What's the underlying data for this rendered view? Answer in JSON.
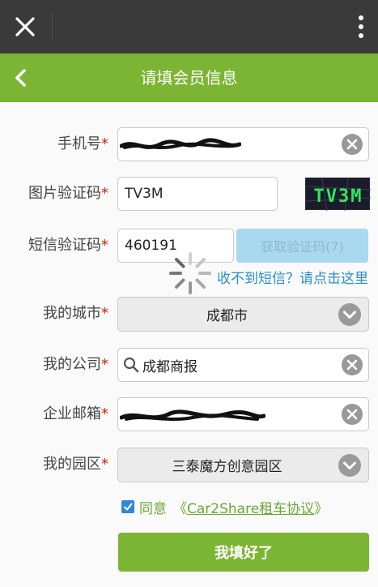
{
  "topbar": {
    "close_icon": "close-icon",
    "more_icon": "more-vertical-icon"
  },
  "navbar": {
    "back_icon": "chevron-left-icon",
    "title": "请填会员信息"
  },
  "form": {
    "phone": {
      "label": "手机号",
      "required_mark": "*"
    },
    "captcha": {
      "label": "图片验证码",
      "required_mark": "*",
      "value": "TV3M",
      "image_text": "TV3M"
    },
    "sms": {
      "label": "短信验证码",
      "required_mark": "*",
      "value": "460191",
      "button_label": "获取验证码(7)",
      "resend_link": "收不到短信？请点击这里"
    },
    "city": {
      "label": "我的城市",
      "required_mark": "*",
      "value": "成都市"
    },
    "company": {
      "label": "我的公司",
      "required_mark": "*",
      "value": "成都商报"
    },
    "email": {
      "label": "企业邮箱",
      "required_mark": "*"
    },
    "park": {
      "label": "我的园区",
      "required_mark": "*",
      "value": "三泰魔方创意园区"
    }
  },
  "agreement": {
    "checked": true,
    "prefix": "同意",
    "open_quote": "《",
    "link_text": "Car2Share租车协议",
    "close_quote": "》"
  },
  "submit_label": "我填好了",
  "colors": {
    "brand_green": "#7cb434",
    "link_blue": "#2a8fc9",
    "required_red": "#d81e06",
    "disabled_button": "#a9d9ee"
  }
}
